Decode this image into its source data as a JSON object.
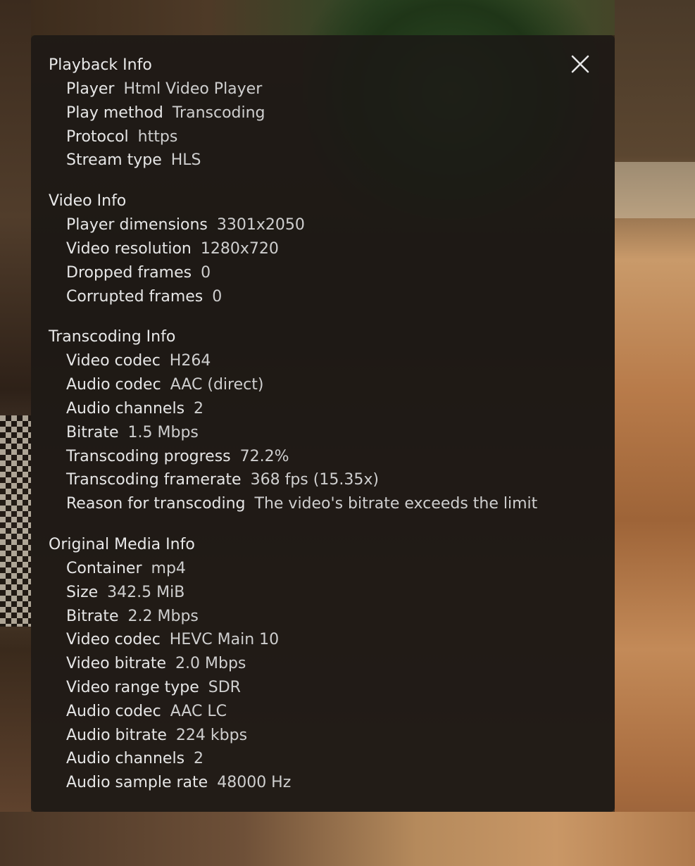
{
  "colors": {
    "panel_background": "#1c1815",
    "text": "#e6e6e6"
  },
  "osd": {
    "close_icon": "close-icon",
    "sections": [
      {
        "title": "Playback Info",
        "rows": [
          {
            "label": "Player",
            "value": "Html Video Player"
          },
          {
            "label": "Play method",
            "value": "Transcoding"
          },
          {
            "label": "Protocol",
            "value": "https"
          },
          {
            "label": "Stream type",
            "value": "HLS"
          }
        ]
      },
      {
        "title": "Video Info",
        "rows": [
          {
            "label": "Player dimensions",
            "value": "3301x2050"
          },
          {
            "label": "Video resolution",
            "value": "1280x720"
          },
          {
            "label": "Dropped frames",
            "value": "0"
          },
          {
            "label": "Corrupted frames",
            "value": "0"
          }
        ]
      },
      {
        "title": "Transcoding Info",
        "rows": [
          {
            "label": "Video codec",
            "value": "H264"
          },
          {
            "label": "Audio codec",
            "value": "AAC (direct)"
          },
          {
            "label": "Audio channels",
            "value": "2"
          },
          {
            "label": "Bitrate",
            "value": "1.5 Mbps"
          },
          {
            "label": "Transcoding progress",
            "value": "72.2%"
          },
          {
            "label": "Transcoding framerate",
            "value": "368 fps (15.35x)"
          },
          {
            "label": "Reason for transcoding",
            "value": "The video's bitrate exceeds the limit"
          }
        ]
      },
      {
        "title": "Original Media Info",
        "rows": [
          {
            "label": "Container",
            "value": "mp4"
          },
          {
            "label": "Size",
            "value": "342.5 MiB"
          },
          {
            "label": "Bitrate",
            "value": "2.2 Mbps"
          },
          {
            "label": "Video codec",
            "value": "HEVC Main 10"
          },
          {
            "label": "Video bitrate",
            "value": "2.0 Mbps"
          },
          {
            "label": "Video range type",
            "value": "SDR"
          },
          {
            "label": "Audio codec",
            "value": "AAC LC"
          },
          {
            "label": "Audio bitrate",
            "value": "224 kbps"
          },
          {
            "label": "Audio channels",
            "value": "2"
          },
          {
            "label": "Audio sample rate",
            "value": "48000 Hz"
          }
        ]
      }
    ]
  }
}
